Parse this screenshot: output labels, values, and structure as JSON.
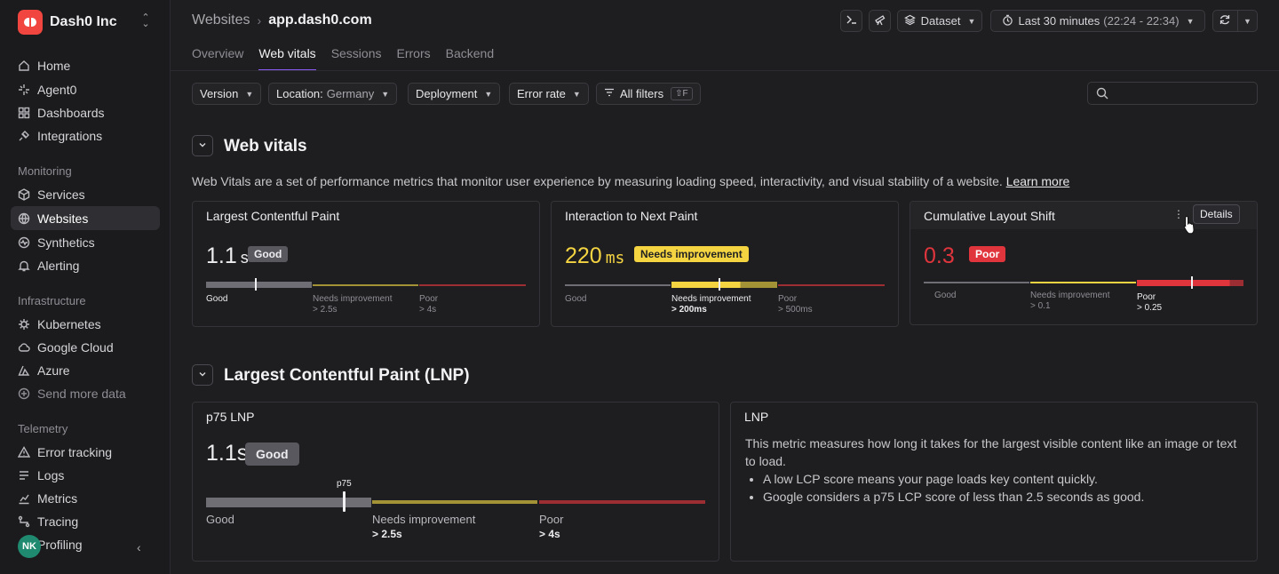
{
  "org": {
    "name": "Dash0 Inc"
  },
  "sidebar": {
    "top_items": [
      {
        "label": "Home",
        "icon": "home-icon"
      },
      {
        "label": "Agent0",
        "icon": "sparkle-icon"
      },
      {
        "label": "Dashboards",
        "icon": "dashboard-icon"
      },
      {
        "label": "Integrations",
        "icon": "plug-icon"
      }
    ],
    "monitoring_label": "Monitoring",
    "monitoring_items": [
      {
        "label": "Services",
        "icon": "cube-icon"
      },
      {
        "label": "Websites",
        "icon": "globe-icon"
      },
      {
        "label": "Synthetics",
        "icon": "pulse-icon"
      },
      {
        "label": "Alerting",
        "icon": "bell-icon"
      }
    ],
    "infra_label": "Infrastructure",
    "infra_items": [
      {
        "label": "Kubernetes",
        "icon": "helm-icon"
      },
      {
        "label": "Google Cloud",
        "icon": "cloud-icon"
      },
      {
        "label": "Azure",
        "icon": "azure-icon"
      },
      {
        "label": "Send more data",
        "icon": "plus-circle-icon"
      }
    ],
    "telemetry_label": "Telemetry",
    "telemetry_items": [
      {
        "label": "Error tracking",
        "icon": "warning-icon"
      },
      {
        "label": "Logs",
        "icon": "logs-icon"
      },
      {
        "label": "Metrics",
        "icon": "metrics-icon"
      },
      {
        "label": "Tracing",
        "icon": "tracing-icon"
      },
      {
        "label": "Profiling",
        "icon": "profiling-icon"
      }
    ],
    "avatar": "NK"
  },
  "header": {
    "breadcrumb_parent": "Websites",
    "breadcrumb_current": "app.dash0.com",
    "dataset_label": "Dataset",
    "time_label": "Last 30 minutes",
    "time_range": "(22:24 - 22:34)"
  },
  "tabs": [
    "Overview",
    "Web vitals",
    "Sessions",
    "Errors",
    "Backend"
  ],
  "filters": {
    "version": "Version",
    "location_label": "Location:",
    "location_value": "Germany",
    "deployment": "Deployment",
    "error_rate": "Error rate",
    "all_filters": "All filters",
    "shortcut": "⇧F"
  },
  "web_vitals": {
    "title": "Web vitals",
    "description": "Web Vitals are a set of performance metrics that monitor user experience by measuring loading speed, interactivity, and visual stability of a website.",
    "learn_more": "Learn more",
    "cards": [
      {
        "title": "Largest Contentful Paint",
        "value": "1.1",
        "unit": "s",
        "badge": "Good",
        "good": "Good",
        "needs": "Needs improvement",
        "needs_thr": "> 2.5s",
        "poor": "Poor",
        "poor_thr": "> 4s"
      },
      {
        "title": "Interaction to Next Paint",
        "value": "220",
        "unit": "ms",
        "badge": "Needs improvement",
        "good": "Good",
        "needs": "Needs improvement",
        "needs_thr": "> 200ms",
        "poor": "Poor",
        "poor_thr": "> 500ms"
      },
      {
        "title": "Cumulative Layout Shift",
        "value": "0.3",
        "unit": "",
        "badge": "Poor",
        "good": "Good",
        "needs": "Needs improvement",
        "needs_thr": "> 0.1",
        "poor": "Poor",
        "poor_thr": "> 0.25"
      }
    ],
    "details_tooltip": "Details"
  },
  "lnp": {
    "title": "Largest Contentful Paint (LNP)",
    "p75_title": "p75 LNP",
    "p75_value": "1.1s",
    "p75_badge": "Good",
    "marker_label": "p75",
    "good": "Good",
    "needs": "Needs improvement",
    "needs_thr": "> 2.5s",
    "poor": "Poor",
    "poor_thr": "> 4s",
    "info_title": "LNP",
    "info_text": "This metric measures how long it takes for the largest visible content like an image or text to load.",
    "info_bullets": [
      "A low LCP score means your page loads key content quickly.",
      "Google considers a p75 LCP score of less than 2.5 seconds as good."
    ]
  },
  "colors": {
    "accent": "#8b5cf6",
    "good": "#6e6e74",
    "needs": "#f5d442",
    "poor": "#e0353d"
  }
}
